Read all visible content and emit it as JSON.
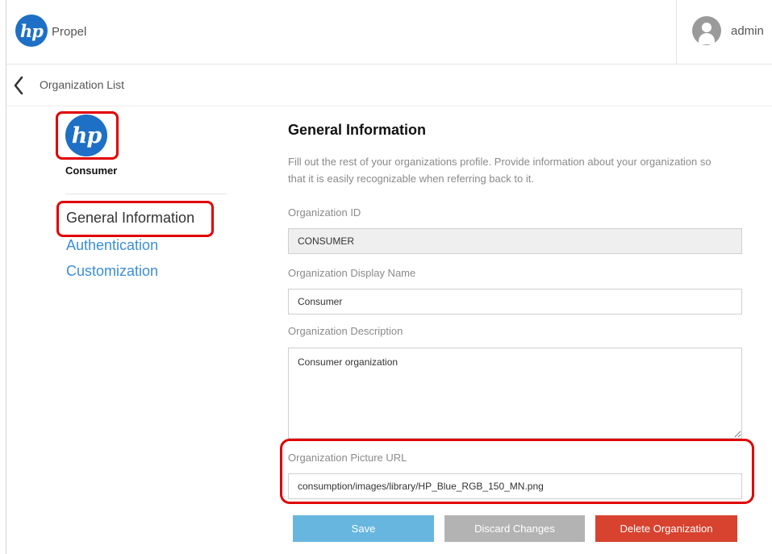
{
  "header": {
    "logo_text": "hp",
    "app_name": "Propel",
    "user_name": "admin"
  },
  "breadcrumb": {
    "label": "Organization List"
  },
  "org": {
    "logo_text": "hp",
    "name": "Consumer"
  },
  "nav": {
    "items": [
      {
        "label": "General Information",
        "active": true
      },
      {
        "label": "Authentication",
        "active": false
      },
      {
        "label": "Customization",
        "active": false
      }
    ]
  },
  "form": {
    "title": "General Information",
    "description": "Fill out the rest of your organizations profile. Provide information about your organization so that it is easily recognizable when referring back to it.",
    "org_id_label": "Organization ID",
    "org_id_value": "CONSUMER",
    "display_name_label": "Organization Display Name",
    "display_name_value": "Consumer",
    "description_label": "Organization Description",
    "description_value": "Consumer organization",
    "picture_url_label": "Organization Picture URL",
    "picture_url_value": "consumption/images/library/HP_Blue_RGB_150_MN.png"
  },
  "buttons": {
    "save": "Save",
    "discard": "Discard Changes",
    "delete": "Delete Organization"
  },
  "colors": {
    "brand_blue": "#1e6fc6",
    "link_blue": "#3a8fd8",
    "save_blue": "#67b6e0",
    "discard_gray": "#b3b3b3",
    "delete_red": "#d7432f",
    "highlight_red": "#e00000"
  }
}
